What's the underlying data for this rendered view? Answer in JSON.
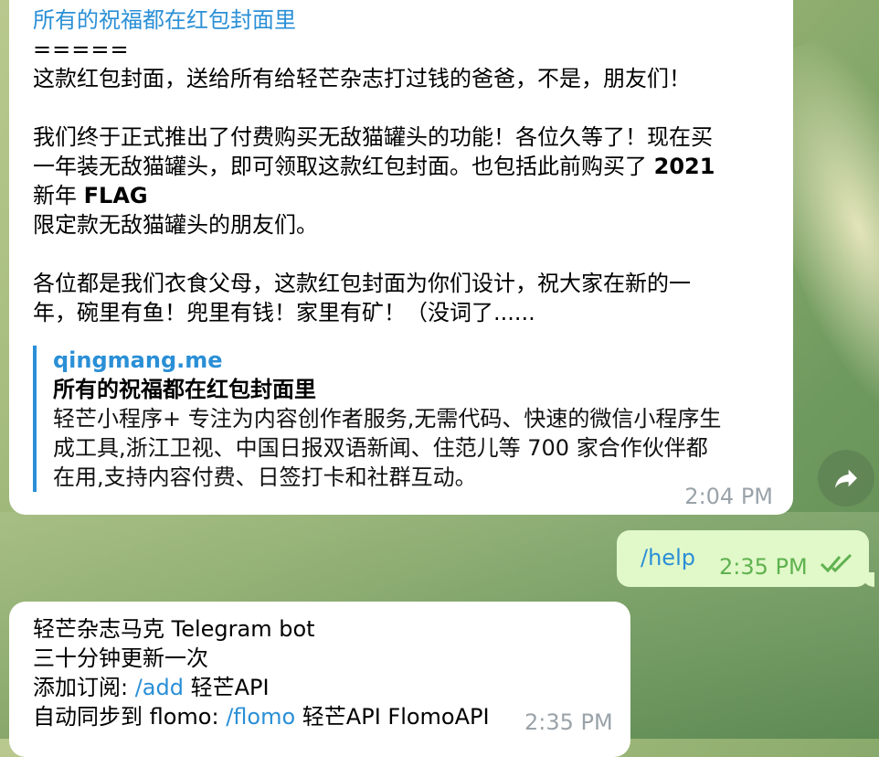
{
  "message1": {
    "title": "所有的祝福都在红包封面里",
    "separator": "=====",
    "line1": "这款红包封面，送给所有给轻芒杂志打过钱的爸爸，不是，朋友们！",
    "para2_line1": "我们终于正式推出了付费购买无敌猫罐头的功能！各位久等了！现在买",
    "para2_line2_a": "一年装无敌猫罐头，即可领取这款红包封面。也包括此前购买了 ",
    "para2_line2_b": "2021",
    "para2_line3_a": "新年 ",
    "para2_line3_b": "FLAG",
    "para2_line4": "限定款无敌猫罐头的朋友们。",
    "para3_line1": "各位都是我们衣食父母，这款红包封面为你们设计，祝大家在新的一",
    "para3_line2": "年，碗里有鱼！兜里有钱！家里有矿！（没词了......",
    "preview": {
      "site": "qingmang.me",
      "title": "所有的祝福都在红包封面里",
      "desc_line1": "轻芒小程序+ 专注为内容创作者服务,无需代码、快速的微信小程序生",
      "desc_line2": "成工具,浙江卫视、中国日报双语新闻、住范儿等 700 家合作伙伴都",
      "desc_line3": "在用,支持内容付费、日签打卡和社群互动。"
    },
    "time": "2:04 PM"
  },
  "message2": {
    "text": "/help",
    "time": "2:35 PM"
  },
  "message3": {
    "line1": "轻芒杂志马克 Telegram bot",
    "line2": "三十分钟更新一次",
    "line3_prefix": "添加订阅: ",
    "line3_cmd": "/add",
    "line3_suffix": " 轻芒API",
    "line4_prefix": "自动同步到 flomo: ",
    "line4_cmd": "/flomo",
    "line4_suffix": " 轻芒API FlomoAPI",
    "time": "2:35 PM"
  },
  "icons": {
    "forward": "forward-arrow-icon",
    "read_status": "double-check-icon"
  },
  "colors": {
    "link": "#2a8fd6",
    "outgoing_bubble": "#e1f8c9",
    "outgoing_time": "#5fb24f",
    "incoming_time": "#9aa3a9"
  }
}
